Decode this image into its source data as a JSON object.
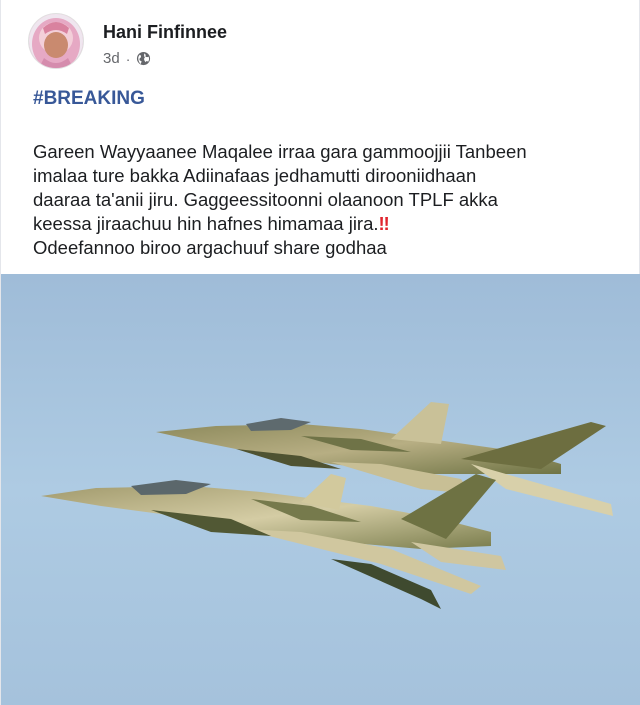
{
  "post": {
    "author_name": "Hani Finfinnee",
    "timestamp": "3d",
    "separator": "·",
    "audience_icon": "globe-icon",
    "hashtag": "#BREAKING",
    "body_lines": [
      "Gareen Wayyaanee Maqalee irraa gara gammoojjii Tanbeen",
      "imalaa ture bakka Adiinafaas jedhamutti dirooniidhaan",
      "daaraa ta'anii jiru. Gaggeessitoonni olaanoon TPLF akka",
      "keessa jiraachuu hin hafnes himamaa jira."
    ],
    "emphasis": "‼",
    "last_line": "Odeefannoo biroo argachuuf share godhaa"
  },
  "colors": {
    "hashtag": "#385898",
    "meta": "#65676b",
    "emphasis": "#e0242d",
    "sky": "#a9c3dd"
  },
  "photo": {
    "subject": "two camouflaged fighter jets in flight"
  }
}
